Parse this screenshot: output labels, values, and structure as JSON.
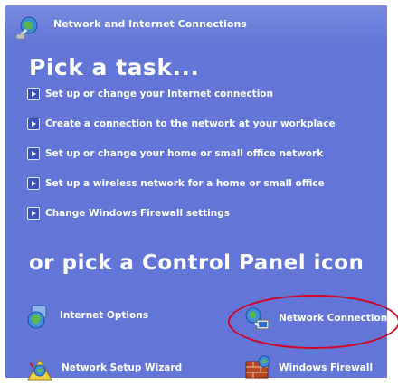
{
  "header": {
    "title": "Network and Internet Connections",
    "icon": "network-globe-icon"
  },
  "task_section": {
    "heading": "Pick a task...",
    "tasks": [
      {
        "label": "Set up or change your Internet connection"
      },
      {
        "label": "Create a connection to the network at your workplace"
      },
      {
        "label": "Set up or change your home or small office network"
      },
      {
        "label": "Set up a wireless network for a home or small office"
      },
      {
        "label": "Change Windows Firewall settings"
      }
    ]
  },
  "control_panel_section": {
    "heading": "or pick a Control Panel icon",
    "icons": [
      {
        "label": "Internet Options",
        "icon": "internet-options-icon"
      },
      {
        "label": "Network Connections",
        "icon": "network-connections-icon"
      },
      {
        "label": "Network Setup Wizard",
        "icon": "network-setup-wizard-icon"
      },
      {
        "label": "Windows Firewall",
        "icon": "windows-firewall-icon"
      }
    ]
  },
  "colors": {
    "panel": "#6375d6",
    "text": "#ffffff",
    "highlight": "#d40020"
  }
}
